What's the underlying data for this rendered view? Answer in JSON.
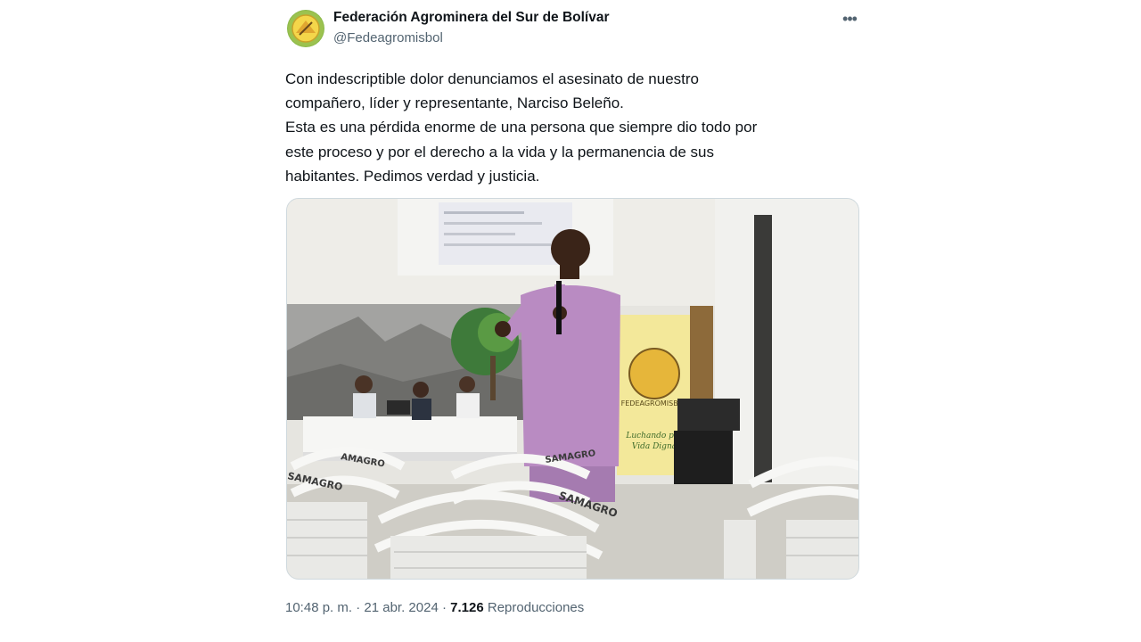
{
  "author": {
    "display_name": "Federación Agrominera del Sur de Bolívar",
    "handle": "@Fedeagromisbol",
    "avatar_icon": "federation-logo"
  },
  "more_icon": "more-options-icon",
  "tweet": {
    "text": "Con indescriptible dolor denunciamos el asesinato de nuestro\ncompañero, líder y representante, Narciso Beleño.\nEsta es una pérdida enorme de una persona que siempre dio todo por\neste proceso y por el derecho a la vida y la permanencia de sus\nhabitantes. Pedimos verdad y justicia."
  },
  "media": {
    "chair_brand": "AMAGRO",
    "chair_brand_alt": "SAMAGRO",
    "banner_logo_text": "FEDEAGROMISBOL",
    "banner_slogan_line1": "Luchando por",
    "banner_slogan_line2": "Vida Digna"
  },
  "meta": {
    "time": "10:48 p. m.",
    "separator": "·",
    "date": "21 abr. 2024",
    "views_count": "7.126",
    "views_label": "Reproducciones"
  }
}
